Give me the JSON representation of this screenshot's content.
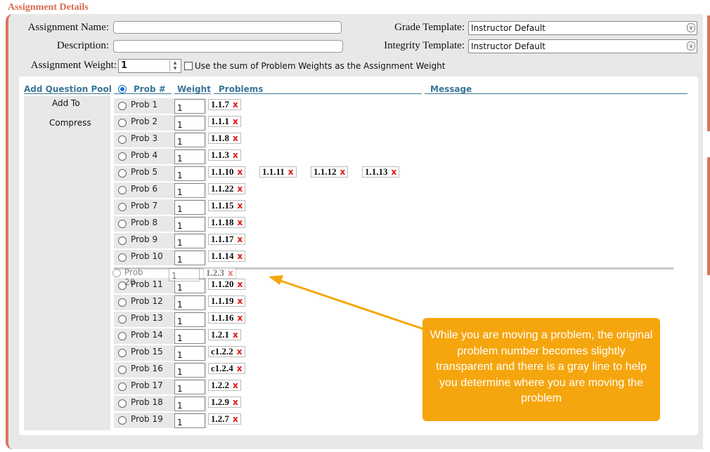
{
  "section_title": "Assignment Details",
  "form": {
    "assignment_name_label": "Assignment Name:",
    "description_label": "Description:",
    "grade_template_label": "Grade Template:",
    "grade_template_value": "Instructor Default",
    "integrity_template_label": "Integrity Template:",
    "integrity_template_value": "Instructor Default",
    "assignment_weight_label": "Assignment Weight:",
    "assignment_weight_value": "1",
    "sum_weights_label": "Use the sum of Problem Weights as the Assignment Weight"
  },
  "table": {
    "add_question_pool": "Add Question Pool",
    "col_prob": "Prob #",
    "col_weight": "Weight",
    "col_problems": "Problems",
    "col_message": "Message",
    "add_to": "Add To",
    "compress": "Compress",
    "rows": [
      {
        "label": "Prob 1",
        "weight": "1",
        "problems": [
          "1.1.7"
        ]
      },
      {
        "label": "Prob 2",
        "weight": "1",
        "problems": [
          "1.1.1"
        ]
      },
      {
        "label": "Prob 3",
        "weight": "1",
        "problems": [
          "1.1.8"
        ]
      },
      {
        "label": "Prob 4",
        "weight": "1",
        "problems": [
          "1.1.3"
        ]
      },
      {
        "label": "Prob 5",
        "weight": "1",
        "problems": [
          "1.1.10",
          "1.1.11",
          "1.1.12",
          "1.1.13"
        ]
      },
      {
        "label": "Prob 6",
        "weight": "1",
        "problems": [
          "1.1.22"
        ]
      },
      {
        "label": "Prob 7",
        "weight": "1",
        "problems": [
          "1.1.15"
        ]
      },
      {
        "label": "Prob 8",
        "weight": "1",
        "problems": [
          "1.1.18"
        ]
      },
      {
        "label": "Prob 9",
        "weight": "1",
        "problems": [
          "1.1.17"
        ]
      },
      {
        "label": "Prob 10",
        "weight": "1",
        "problems": [
          "1.1.14"
        ]
      },
      {
        "label": "Prob 11",
        "weight": "1",
        "problems": [
          "1.1.20"
        ]
      },
      {
        "label": "Prob 12",
        "weight": "1",
        "problems": [
          "1.1.19"
        ]
      },
      {
        "label": "Prob 13",
        "weight": "1",
        "problems": [
          "1.1.16"
        ]
      },
      {
        "label": "Prob 14",
        "weight": "1",
        "problems": [
          "1.2.1"
        ]
      },
      {
        "label": "Prob 15",
        "weight": "1",
        "problems": [
          "c1.2.2"
        ]
      },
      {
        "label": "Prob 16",
        "weight": "1",
        "problems": [
          "c1.2.4"
        ]
      },
      {
        "label": "Prob 17",
        "weight": "1",
        "problems": [
          "1.2.2"
        ]
      },
      {
        "label": "Prob 18",
        "weight": "1",
        "problems": [
          "1.2.9"
        ]
      },
      {
        "label": "Prob 19",
        "weight": "1",
        "problems": [
          "1.2.7"
        ]
      }
    ],
    "dragging_row": {
      "label": "Prob 20",
      "weight": "1",
      "problems": [
        "1.2.3"
      ]
    },
    "remove_symbol": "x"
  },
  "callout": {
    "text": "While you are moving a problem, the original problem number becomes slightly transparent and there is a gray line to help you determine where you are moving the problem",
    "color": "#f5a60e"
  },
  "colors": {
    "accent": "#d9765a",
    "header_blue": "#3a7596",
    "remove_red": "#e01010"
  }
}
